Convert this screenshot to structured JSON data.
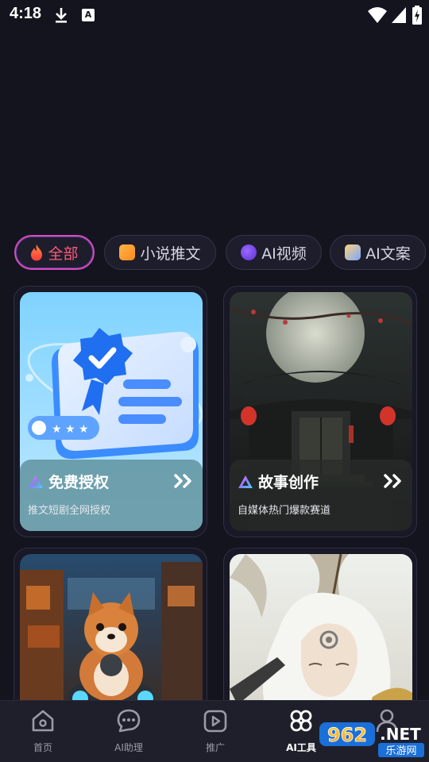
{
  "status_bar": {
    "time": "4:18",
    "icons": [
      "download-icon",
      "app-notification-icon",
      "wifi-icon",
      "signal-icon",
      "battery-charging-icon"
    ],
    "app_icon_letter": "A"
  },
  "filters": [
    {
      "label": "全部",
      "icon": "fire-icon",
      "active": true
    },
    {
      "label": "小说推文",
      "icon": "novel-icon",
      "active": false
    },
    {
      "label": "AI视频",
      "icon": "video-icon",
      "active": false
    },
    {
      "label": "AI文案",
      "icon": "copywriting-icon",
      "active": false
    }
  ],
  "cards": [
    {
      "title": "免费授权",
      "subtitle": "推文短剧全网授权",
      "image": "certificate-illustration"
    },
    {
      "title": "故事创作",
      "subtitle": "自媒体热门爆款赛道",
      "image": "chinese-gate-moon-night"
    },
    {
      "title": "",
      "subtitle": "",
      "image": "shiba-dog-motorcycle"
    },
    {
      "title": "",
      "subtitle": "",
      "image": "white-haired-xianxia-character"
    }
  ],
  "bottom_nav": [
    {
      "label": "首页",
      "icon": "home-icon",
      "active": false
    },
    {
      "label": "AI助理",
      "icon": "chat-icon",
      "active": false
    },
    {
      "label": "推广",
      "icon": "play-icon",
      "active": false
    },
    {
      "label": "AI工具",
      "icon": "tools-grid-icon",
      "active": true
    },
    {
      "label": "",
      "icon": "profile-icon",
      "active": false
    }
  ],
  "watermark": {
    "brand": "962",
    "tld": ".NET",
    "site": "乐游网"
  },
  "colors": {
    "background": "#14141f",
    "active_chip_text": "#ff5a78",
    "active_chip_border": "#d74bbc",
    "nav_bg": "#1f1f2b"
  }
}
